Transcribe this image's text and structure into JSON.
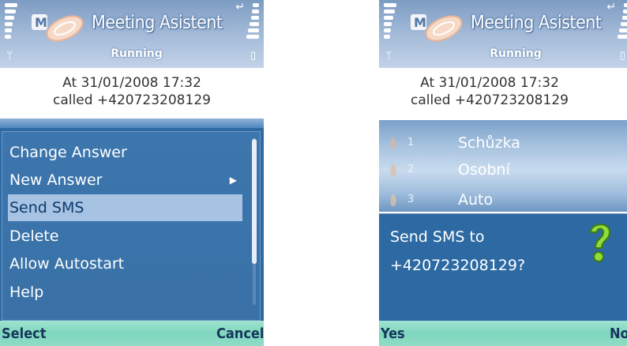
{
  "app": {
    "title": "Meeting Asistent",
    "status": "Running"
  },
  "call": {
    "line1": "At 31/01/2008 17:32",
    "line2": "called +420723208129"
  },
  "menu": {
    "items": [
      {
        "label": "Change Answer",
        "has_submenu": false,
        "selected": false
      },
      {
        "label": "New Answer",
        "has_submenu": true,
        "selected": false
      },
      {
        "label": "Send SMS",
        "has_submenu": false,
        "selected": true
      },
      {
        "label": "Delete",
        "has_submenu": false,
        "selected": false
      },
      {
        "label": "Allow Autostart",
        "has_submenu": false,
        "selected": false
      },
      {
        "label": "Help",
        "has_submenu": false,
        "selected": false
      }
    ]
  },
  "softkeys_left": {
    "left": "Select",
    "right": "Cancel"
  },
  "profiles": [
    {
      "num": "1",
      "name": "Schůzka"
    },
    {
      "num": "2",
      "name": "Osobní"
    },
    {
      "num": "3",
      "name": "Auto"
    }
  ],
  "dialog": {
    "line1": "Send SMS to",
    "line2": "+420723208129?"
  },
  "softkeys_right": {
    "left": "Yes",
    "right": "No"
  },
  "colors": {
    "menu_bg": "#3a73a9",
    "selected_bg": "#a6c3e3",
    "softkey_bg": "#8fdcc6",
    "header_bg": "#9fb7d6"
  }
}
